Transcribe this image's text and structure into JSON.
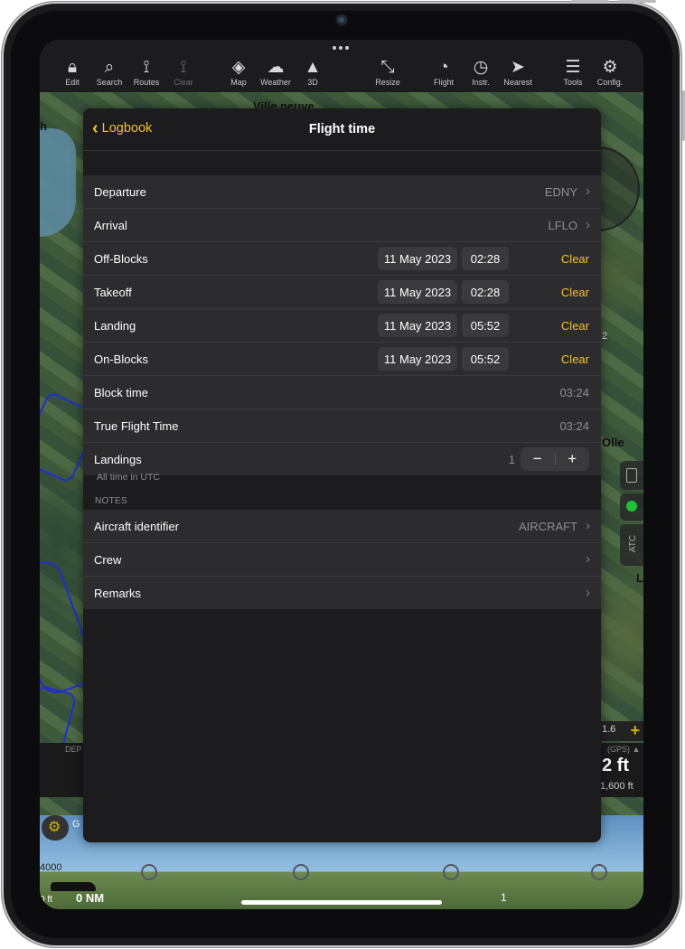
{
  "toolbar": {
    "items": [
      {
        "label": "Edit",
        "icon": "lock-icon"
      },
      {
        "label": "Search",
        "icon": "search-icon"
      },
      {
        "label": "Routes",
        "icon": "routes-icon"
      },
      {
        "label": "Clear",
        "icon": "clear-icon"
      },
      {
        "label": "Map",
        "icon": "layers-icon"
      },
      {
        "label": "Weather",
        "icon": "weather-icon"
      },
      {
        "label": "3D",
        "icon": "terrain-icon"
      },
      {
        "label": "Resize",
        "icon": "resize-icon"
      },
      {
        "label": "Flight",
        "icon": "stopwatch-icon"
      },
      {
        "label": "Instr.",
        "icon": "gauge-icon"
      },
      {
        "label": "Nearest",
        "icon": "nearest-icon"
      },
      {
        "label": "Tools",
        "icon": "menu-icon"
      },
      {
        "label": "Config.",
        "icon": "gear-icon"
      }
    ]
  },
  "map": {
    "city_label": "Ville neuve",
    "letter_h": "h",
    "olle_label": "Olle",
    "letter_l": "L",
    "num_2": "2",
    "atc": "ATC",
    "dep": "DEP",
    "alt_value": "2 ft",
    "gps_label": "(GPS) ▲",
    "alt_ref": "1,600 ft",
    "scale_1_6": "1.6",
    "profile_4000": "4000",
    "zero_ft": "0 ft",
    "zero_nm": "0 NM",
    "one": "1",
    "g_letter": "G"
  },
  "panel": {
    "back_label": "Logbook",
    "title": "Flight time",
    "departure": {
      "label": "Departure",
      "value": "EDNY"
    },
    "arrival": {
      "label": "Arrival",
      "value": "LFLO"
    },
    "off_blocks": {
      "label": "Off-Blocks",
      "date": "11 May 2023",
      "time": "02:28",
      "action": "Clear"
    },
    "takeoff": {
      "label": "Takeoff",
      "date": "11 May 2023",
      "time": "02:28",
      "action": "Clear"
    },
    "landing": {
      "label": "Landing",
      "date": "11 May 2023",
      "time": "05:52",
      "action": "Clear"
    },
    "on_blocks": {
      "label": "On-Blocks",
      "date": "11 May 2023",
      "time": "05:52",
      "action": "Clear"
    },
    "block_time": {
      "label": "Block time",
      "value": "03:24"
    },
    "true_flight_time": {
      "label": "True Flight Time",
      "value": "03:24"
    },
    "landings": {
      "label": "Landings",
      "value": "1",
      "minus": "−",
      "plus": "+"
    },
    "footnote": "All time in UTC",
    "notes_header": "NOTES",
    "aircraft_identifier": {
      "label": "Aircraft identifier",
      "value": "AIRCRAFT"
    },
    "crew": {
      "label": "Crew"
    },
    "remarks": {
      "label": "Remarks"
    }
  },
  "colors": {
    "accent": "#f2c12e",
    "panel_bg": "#1c1c1e",
    "row_bg": "#2c2c2e"
  }
}
